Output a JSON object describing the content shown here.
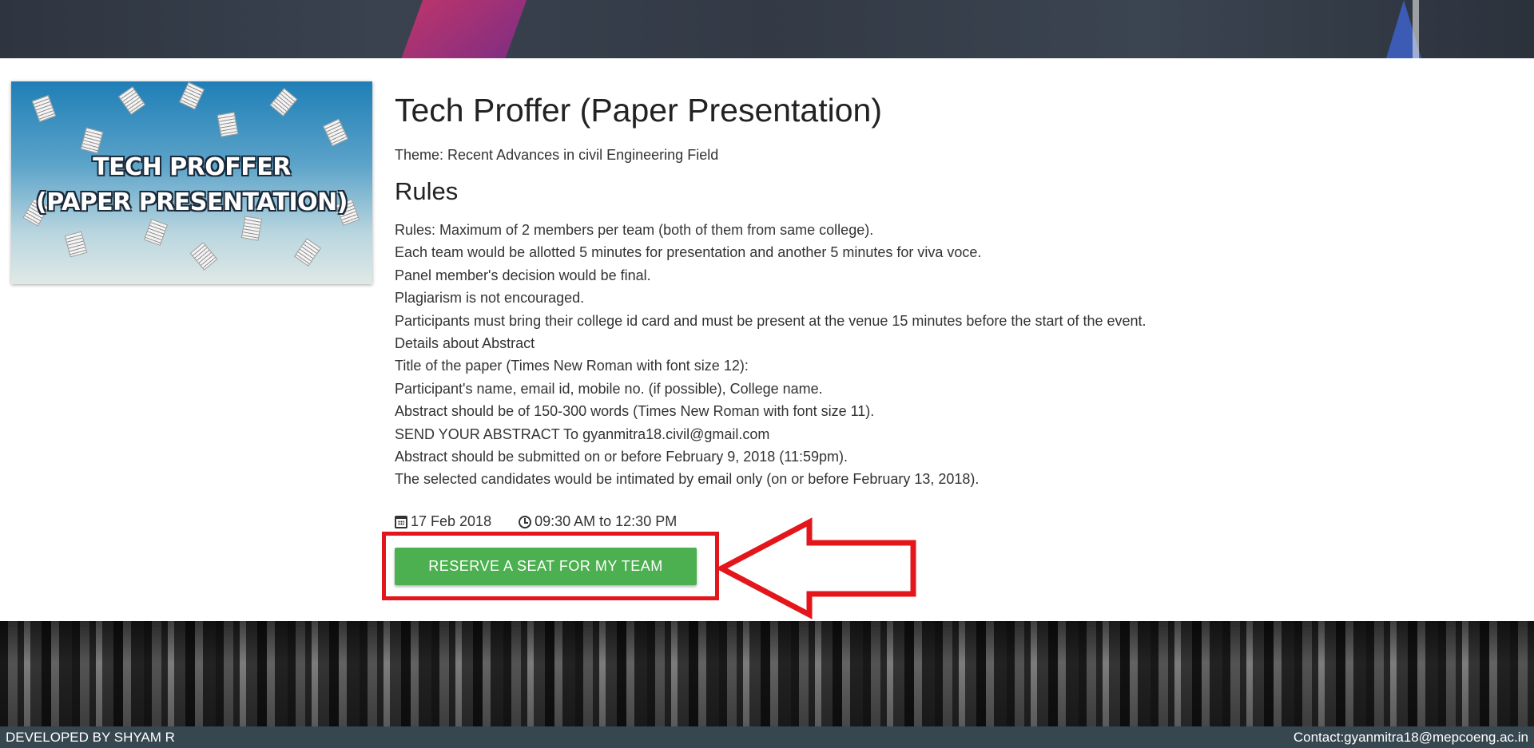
{
  "header": {
    "banner": "decorative-banner"
  },
  "event": {
    "image_text": "TECH PROFFER\n(PAPER PRESENTATION)",
    "title": "Tech Proffer (Paper Presentation)",
    "theme": "Theme: Recent Advances in civil Engineering Field",
    "rules_heading": "Rules",
    "rules": [
      "Rules: Maximum of 2 members per team (both of them from same college).",
      "Each team would be allotted 5 minutes for presentation and another 5 minutes for viva voce.",
      "Panel member's decision would be final.",
      "Plagiarism is not encouraged.",
      "Participants must bring their college id card and must be present at the venue 15 minutes before the start of the event.",
      "Details about Abstract",
      "Title of the paper (Times New Roman with font size 12):",
      "Participant's name, email id, mobile no. (if possible), College name.",
      "Abstract should be of 150-300 words (Times New Roman with font size 11).",
      "SEND YOUR ABSTRACT To gyanmitra18.civil@gmail.com",
      "Abstract should be submitted on or before February 9, 2018 (11:59pm).",
      "The selected candidates would be intimated by email only (on or before February 13, 2018)."
    ],
    "date": "17 Feb 2018",
    "time": "09:30 AM to 12:30 PM",
    "reserve_label": "RESERVE A SEAT FOR MY TEAM"
  },
  "icons": {
    "date": "calendar-icon",
    "time": "clock-icon"
  },
  "colors": {
    "button": "#4caf50",
    "annotation": "#e3161b",
    "footer": "#37474f"
  },
  "footer": {
    "developer": "DEVELOPED BY SHYAM R",
    "contact": "Contact:gyanmitra18@mepcoeng.ac.in"
  }
}
